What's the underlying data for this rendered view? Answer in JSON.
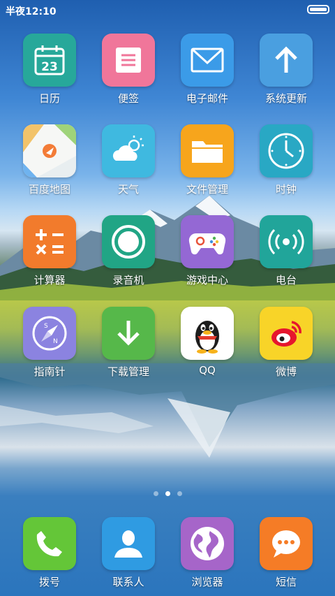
{
  "status_bar": {
    "time": "半夜12:10"
  },
  "apps": [
    {
      "label": "日历",
      "icon": "calendar-icon",
      "color": "#27a89a",
      "day": "23"
    },
    {
      "label": "便签",
      "icon": "notes-icon",
      "color": "#f0769a"
    },
    {
      "label": "电子邮件",
      "icon": "mail-icon",
      "color": "#3b9be8"
    },
    {
      "label": "系统更新",
      "icon": "update-arrow-icon",
      "color": "#4a9fe0"
    },
    {
      "label": "百度地图",
      "icon": "map-icon",
      "color": "#e8eef0"
    },
    {
      "label": "天气",
      "icon": "weather-icon",
      "color": "#3fb9e0"
    },
    {
      "label": "文件管理",
      "icon": "folder-icon",
      "color": "#f7a51c"
    },
    {
      "label": "时钟",
      "icon": "clock-icon",
      "color": "#29a8c4"
    },
    {
      "label": "计算器",
      "icon": "calculator-icon",
      "color": "#f27b2c"
    },
    {
      "label": "录音机",
      "icon": "recorder-icon",
      "color": "#21a585"
    },
    {
      "label": "游戏中心",
      "icon": "gamepad-icon",
      "color": "#9468d4"
    },
    {
      "label": "电台",
      "icon": "radio-icon",
      "color": "#21a59a"
    },
    {
      "label": "指南针",
      "icon": "compass-icon",
      "color": "#8b83e0"
    },
    {
      "label": "下载管理",
      "icon": "download-icon",
      "color": "#56b84a"
    },
    {
      "label": "QQ",
      "icon": "qq-penguin-icon",
      "color": "#ffffff"
    },
    {
      "label": "微博",
      "icon": "weibo-icon",
      "color": "#f8d428"
    }
  ],
  "dock": [
    {
      "label": "拨号",
      "icon": "phone-icon",
      "color": "#64c638"
    },
    {
      "label": "联系人",
      "icon": "contact-icon",
      "color": "#2f9be2"
    },
    {
      "label": "浏览器",
      "icon": "browser-globe-icon",
      "color": "#a665c9"
    },
    {
      "label": "短信",
      "icon": "message-icon",
      "color": "#f57c26"
    }
  ],
  "page_indicator": {
    "pages": 3,
    "current": 2
  }
}
